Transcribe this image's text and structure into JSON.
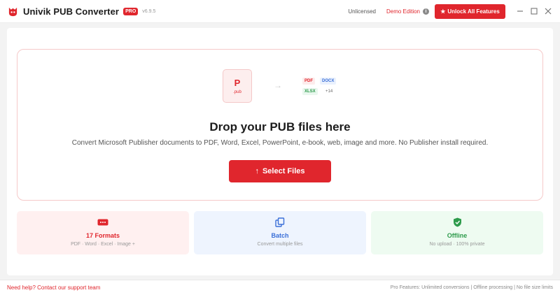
{
  "titlebar": {
    "app_title": "Univik PUB Converter",
    "pro_badge": "PRO",
    "version": "v6.9.5",
    "license_status": "Unlicensed",
    "edition": "Demo Edition",
    "unlock_label": "Unlock All Features"
  },
  "dropzone": {
    "file_tile_letter": "P",
    "file_tile_ext": ".pub",
    "formats": [
      "PDF",
      "DOCX",
      "XLSX",
      "+14"
    ],
    "title": "Drop your PUB files here",
    "subtitle": "Convert Microsoft Publisher documents to PDF, Word, Excel, PowerPoint, e-book, web, image and more. No Publisher install required.",
    "select_label": "Select Files"
  },
  "features": [
    {
      "title": "17 Formats",
      "subtitle": "PDF · Word · Excel · Image +",
      "icon": "format-icon"
    },
    {
      "title": "Batch",
      "subtitle": "Convert multiple files",
      "icon": "batch-icon"
    },
    {
      "title": "Offline",
      "subtitle": "No upload · 100% private",
      "icon": "shield-check-icon"
    }
  ],
  "footer": {
    "help_text": "Need help? Contact our support team",
    "pro_features": "Pro Features: Unlimited conversions | Offline processing | No file size limits"
  },
  "colors": {
    "accent": "#e0262d",
    "blue": "#3a6fd8",
    "green": "#2e9b4c"
  }
}
